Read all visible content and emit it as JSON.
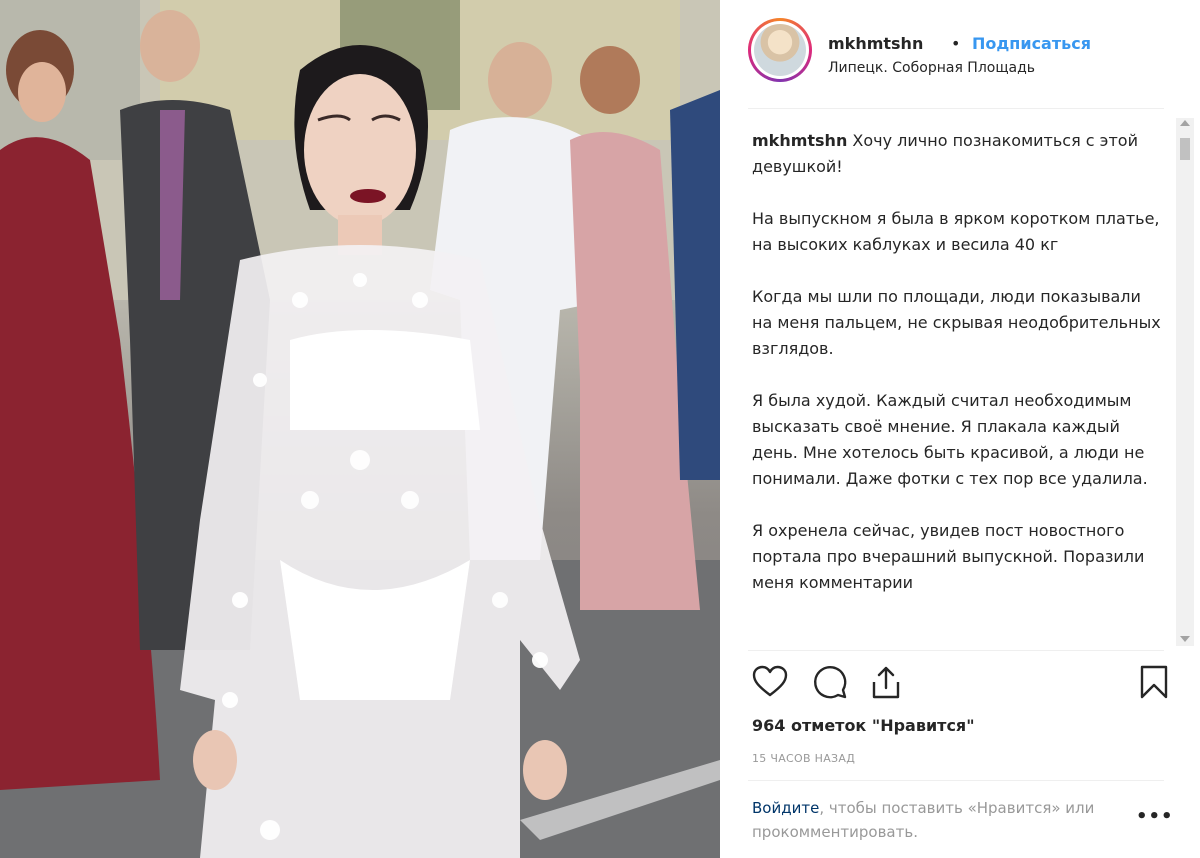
{
  "post": {
    "username": "mkhmtshn",
    "separator": "•",
    "follow_label": "Подписаться",
    "location": "Липецк. Соборная Площадь",
    "caption_text": "Хочу лично познакомиться с этой девушкой!\n\nНа выпускном я была в ярком коротком платье, на высоких каблуках и весила 40 кг\n\nКогда мы шли по площади, люди показывали на меня пальцем, не скрывая неодобрительных взглядов.\n\nЯ была худой. Каждый считал необходимым высказать своё мнение. Я плакала каждый день. Мне хотелось быть красивой, а люди не понимали. Даже фотки с тех пор все удалила.\n\nЯ охренела сейчас, увидев пост новостного портала про вчерашний выпускной. Поразили меня комментарии",
    "likes": "964 отметок \"Нравится\"",
    "time_ago": "15 ЧАСОВ НАЗАД",
    "login_link": "Войдите",
    "login_text": ", чтобы поставить «Нравится» или прокомментировать.",
    "more_label": "•••"
  },
  "icons": {
    "like": "heart-icon",
    "comment": "comment-bubble-icon",
    "share": "share-icon",
    "save": "bookmark-icon"
  },
  "colors": {
    "link_blue": "#3897f0",
    "dark_link": "#003569",
    "muted": "#999999",
    "text": "#262626"
  }
}
